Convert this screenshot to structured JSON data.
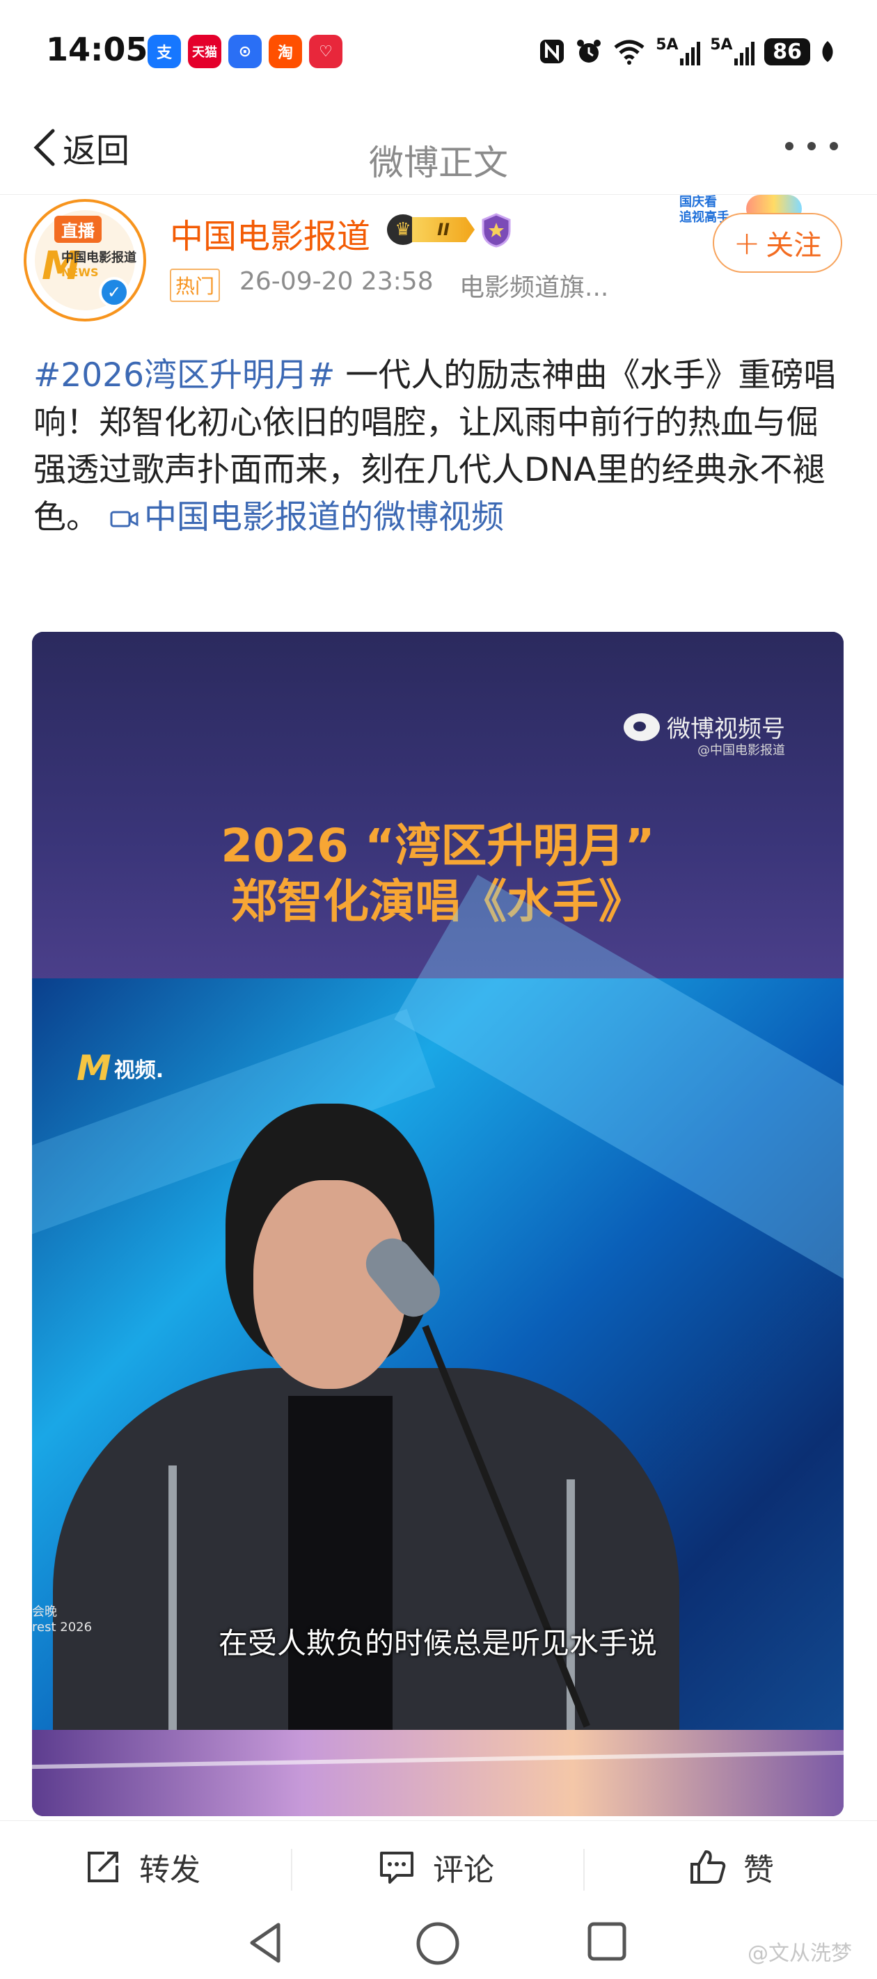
{
  "status_bar": {
    "time": "14:05",
    "apps": [
      {
        "label": "支",
        "color": "#1677ff",
        "name": "alipay-icon"
      },
      {
        "label": "天猫",
        "color": "#e4002b",
        "name": "tmall-icon"
      },
      {
        "label": "⊙",
        "color": "#2a6ff5",
        "name": "app-icon"
      },
      {
        "label": "淘",
        "color": "#ff5000",
        "name": "taobao-icon"
      },
      {
        "label": "♡",
        "color": "#e8273b",
        "name": "pinduoduo-icon"
      }
    ],
    "network_1": "5A",
    "network_2": "5A",
    "battery": "86"
  },
  "nav": {
    "back_label": "返回",
    "title": "微博正文"
  },
  "author": {
    "avatar_live": "直播",
    "avatar_brand": "中国电影报道",
    "avatar_news": "NEWS",
    "name": "中国电影报道",
    "vip_level": "II",
    "hot_tag": "热门",
    "timestamp": "26-09-20 23:58",
    "source": "电影频道旗...",
    "holiday_badge": "国庆看\n追视高手",
    "follow_label": "关注"
  },
  "post": {
    "topic": "#2026湾区升明月#",
    "text": " 一代人的励志神曲《水手》重磅唱响！郑智化初心依旧的唱腔，让风雨中前行的热血与倔强透过歌声扑面而来，刻在几代人DNA里的经典永不褪色。 ",
    "video_link": "中国电影报道的微博视频"
  },
  "video": {
    "platform_name": "微博视频号",
    "platform_handle": "@中国电影报道",
    "title_line1": "2026 “湾区升明月”",
    "title_line2": "郑智化演唱《水手》",
    "channel_logo": "视频.",
    "event_tag": "会晚\nrest 2026",
    "subtitle": "在受人欺负的时候总是听见水手说"
  },
  "actions": {
    "repost": "转发",
    "comment": "评论",
    "like": "赞"
  },
  "watermark": "@文从洗梦"
}
